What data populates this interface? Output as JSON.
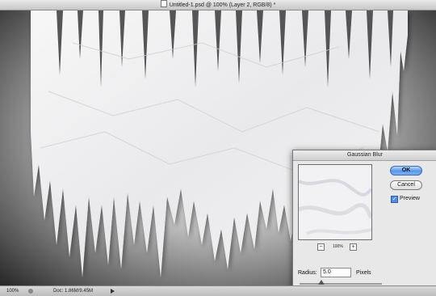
{
  "window": {
    "title": "Untitled-1.psd @ 100% (Layer 2, RGB/8) *"
  },
  "status_bar": {
    "zoom": "100%",
    "doc_size": "Doc: 1.86M/9.45M"
  },
  "dialog": {
    "title": "Gaussian Blur",
    "ok_label": "OK",
    "cancel_label": "Cancel",
    "preview_label": "Preview",
    "preview_checked": true,
    "preview_zoom": "100%",
    "radius_label": "Radius:",
    "radius_value": "5.0",
    "radius_unit": "Pixels",
    "zoom_out_symbol": "−",
    "zoom_in_symbol": "+"
  },
  "icons": {
    "document": "document-icon",
    "status": "status-indicator-icon",
    "status_menu": "triangle-right-icon",
    "zoom_out": "minus-icon",
    "zoom_in": "plus-icon",
    "preview_check": "checkmark-icon",
    "slider": "slider-thumb-icon"
  }
}
